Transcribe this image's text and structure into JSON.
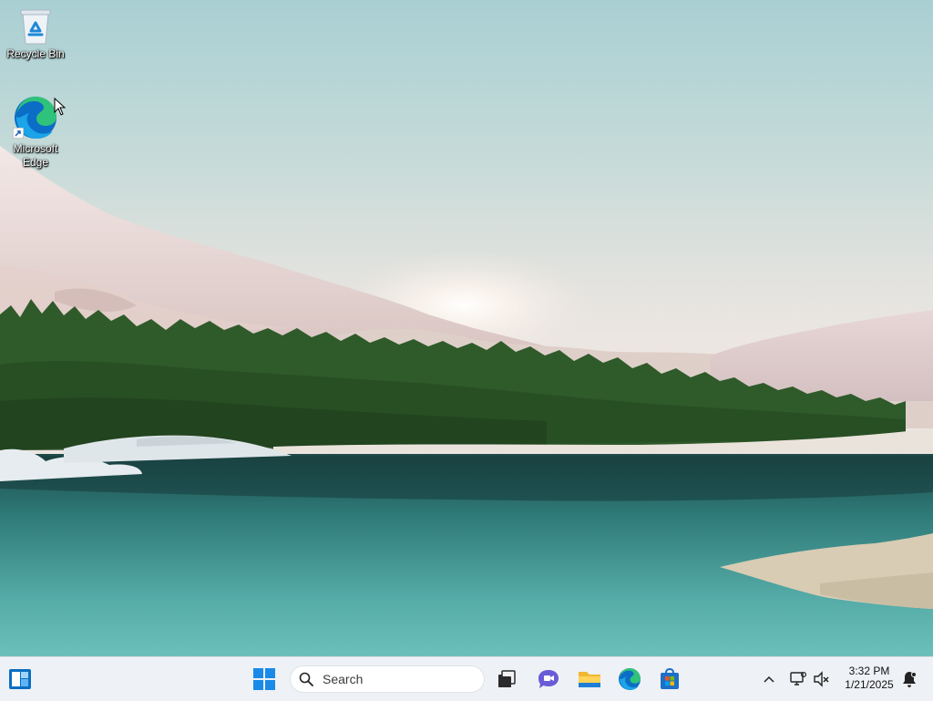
{
  "desktop": {
    "icons": [
      {
        "label": "Recycle Bin",
        "icon": "recycle-bin-icon"
      },
      {
        "label": "Microsoft\nEdge",
        "icon": "edge-icon"
      }
    ]
  },
  "taskbar": {
    "search": {
      "placeholder": "Search"
    },
    "apps": [
      {
        "name": "widgets",
        "icon": "widgets-icon"
      },
      {
        "name": "start",
        "icon": "windows-logo-icon"
      },
      {
        "name": "task-view",
        "icon": "task-view-icon"
      },
      {
        "name": "chat",
        "icon": "chat-icon"
      },
      {
        "name": "file-explorer",
        "icon": "folder-icon"
      },
      {
        "name": "edge",
        "icon": "edge-icon"
      },
      {
        "name": "store",
        "icon": "store-icon"
      }
    ],
    "tray": {
      "time": "3:32 PM",
      "date": "1/21/2025"
    }
  },
  "colors": {
    "accent": "#0078d4",
    "taskbar_bg": "#eef1f5"
  }
}
